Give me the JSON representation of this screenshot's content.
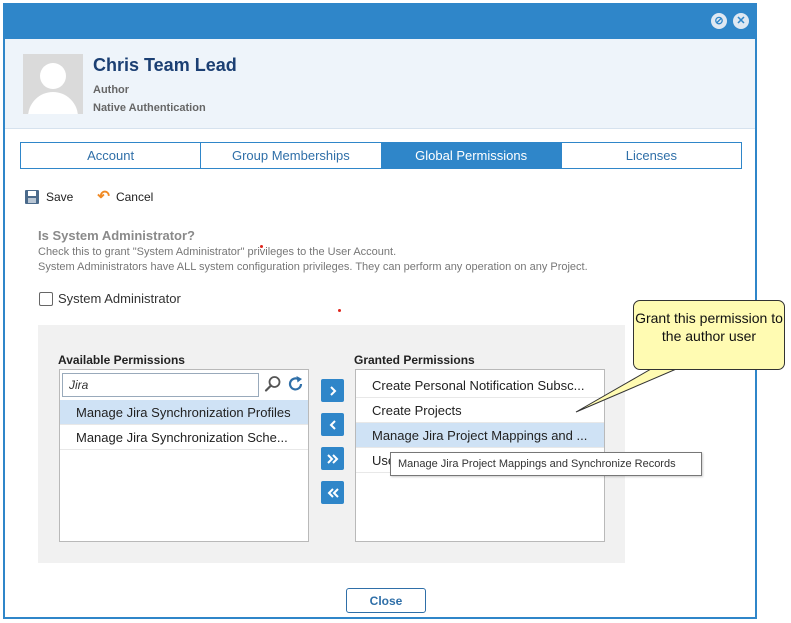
{
  "user": {
    "name": "Chris Team Lead",
    "role": "Author",
    "auth": "Native Authentication"
  },
  "tabs": [
    {
      "label": "Account",
      "active": false
    },
    {
      "label": "Group Memberships",
      "active": false
    },
    {
      "label": "Global Permissions",
      "active": true
    },
    {
      "label": "Licenses",
      "active": false
    }
  ],
  "toolbar": {
    "save_label": "Save",
    "cancel_label": "Cancel"
  },
  "sysadmin": {
    "title": "Is System Administrator?",
    "desc1": "Check this to grant \"System Administrator\" privileges to the User Account.",
    "desc2": "System Administrators have ALL system configuration privileges. They can perform any operation on any Project.",
    "checkbox_label": "System Administrator",
    "checked": false
  },
  "permissions": {
    "available_label": "Available Permissions",
    "granted_label": "Granted Permissions",
    "search_value": "Jira",
    "available": [
      "Manage Jira Synchronization Profiles",
      "Manage Jira Synchronization Sche..."
    ],
    "granted": [
      "Create Personal Notification Subsc...",
      "Create Projects",
      "Manage Jira Project Mappings and ...",
      "Use"
    ]
  },
  "tooltip": "Manage Jira Project Mappings and Synchronize Records",
  "callout": "Grant this permission to the author user",
  "close_label": "Close",
  "icons": {
    "collapse": "collapse-circle-icon",
    "close": "close-circle-icon",
    "save": "floppy-disk-icon",
    "cancel": "undo-arrow-icon",
    "search": "magnifier-icon",
    "refresh": "refresh-icon",
    "move_right": "chevron-right-icon",
    "move_left": "chevron-left-icon",
    "move_all_right": "double-chevron-right-icon",
    "move_all_left": "double-chevron-left-icon"
  },
  "colors": {
    "accent": "#2f86c9",
    "name": "#1b3f73",
    "selection": "#cfe2f5",
    "callout": "#fffbb2"
  }
}
